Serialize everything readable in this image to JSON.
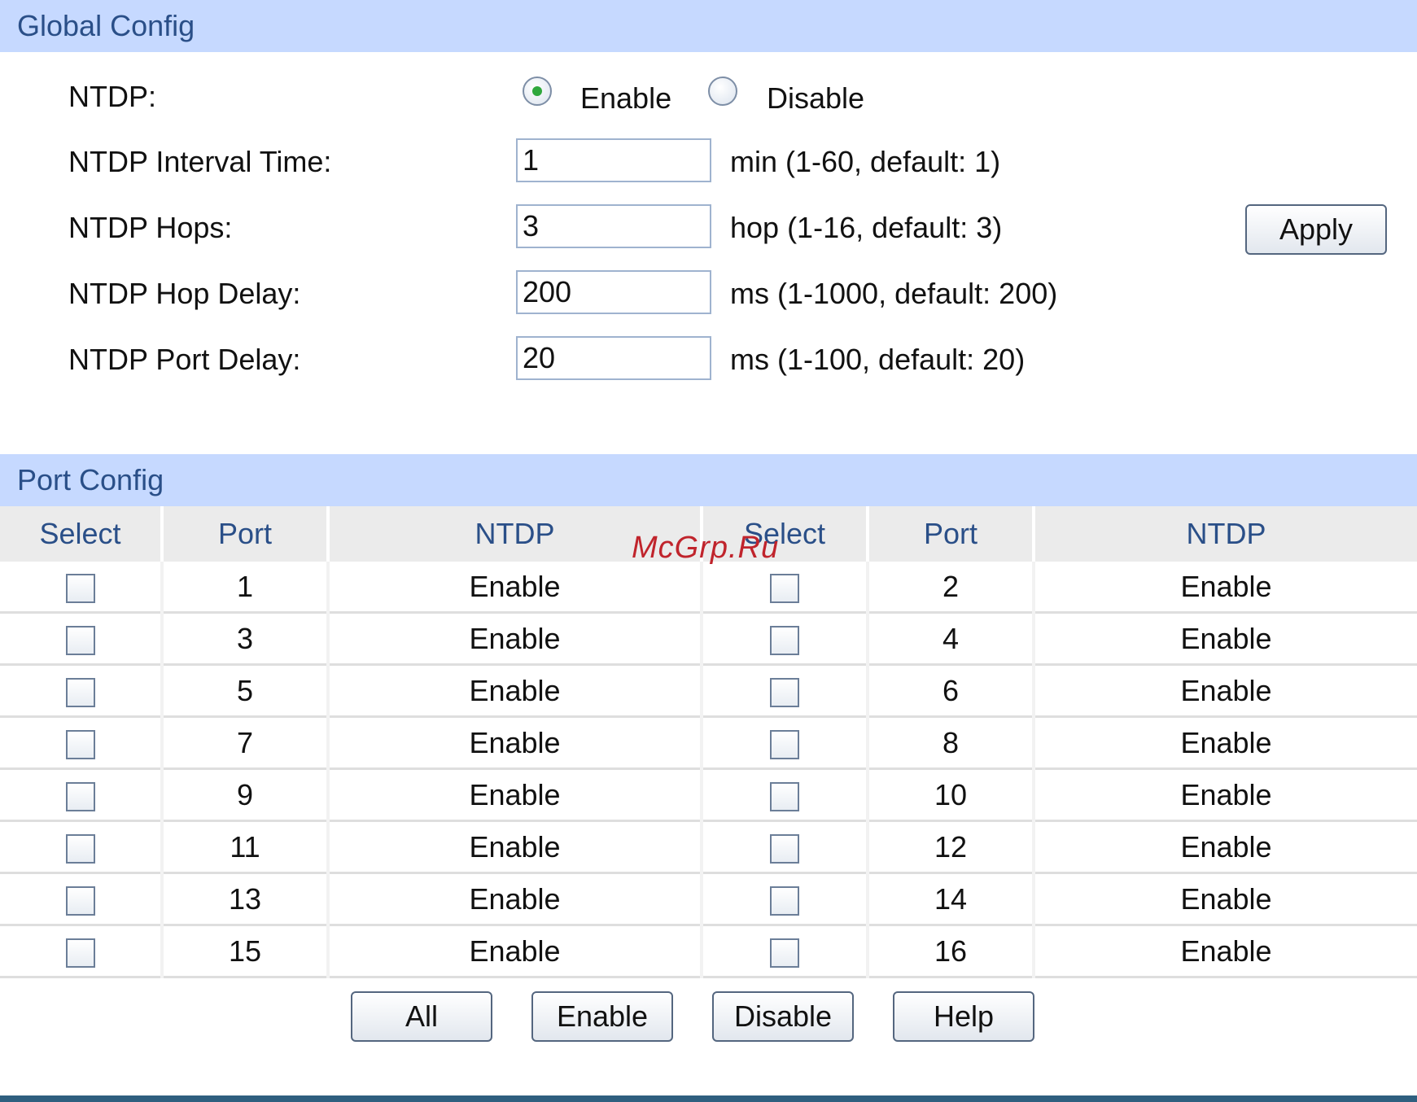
{
  "global_config": {
    "title": "Global Config",
    "ntdp": {
      "label": "NTDP:",
      "options": [
        "Enable",
        "Disable"
      ],
      "selected": "Enable"
    },
    "fields": [
      {
        "label": "NTDP Interval Time:",
        "value": "1",
        "hint": "min (1-60, default: 1)"
      },
      {
        "label": "NTDP Hops:",
        "value": "3",
        "hint": "hop (1-16, default: 3)"
      },
      {
        "label": "NTDP Hop Delay:",
        "value": "200",
        "hint": "ms (1-1000, default: 200)"
      },
      {
        "label": "NTDP Port Delay:",
        "value": "20",
        "hint": "ms (1-100, default: 20)"
      }
    ],
    "apply_label": "Apply"
  },
  "port_config": {
    "title": "Port Config",
    "columns": [
      "Select",
      "Port",
      "NTDP",
      "Select",
      "Port",
      "NTDP"
    ],
    "rows": [
      {
        "port_a": "1",
        "ntdp_a": "Enable",
        "port_b": "2",
        "ntdp_b": "Enable"
      },
      {
        "port_a": "3",
        "ntdp_a": "Enable",
        "port_b": "4",
        "ntdp_b": "Enable"
      },
      {
        "port_a": "5",
        "ntdp_a": "Enable",
        "port_b": "6",
        "ntdp_b": "Enable"
      },
      {
        "port_a": "7",
        "ntdp_a": "Enable",
        "port_b": "8",
        "ntdp_b": "Enable"
      },
      {
        "port_a": "9",
        "ntdp_a": "Enable",
        "port_b": "10",
        "ntdp_b": "Enable"
      },
      {
        "port_a": "11",
        "ntdp_a": "Enable",
        "port_b": "12",
        "ntdp_b": "Enable"
      },
      {
        "port_a": "13",
        "ntdp_a": "Enable",
        "port_b": "14",
        "ntdp_b": "Enable"
      },
      {
        "port_a": "15",
        "ntdp_a": "Enable",
        "port_b": "16",
        "ntdp_b": "Enable"
      }
    ],
    "buttons": [
      "All",
      "Enable",
      "Disable",
      "Help"
    ]
  },
  "watermark": "McGrp.Ru",
  "colors": {
    "header_bg": "#c6d9ff",
    "header_text": "#2a4f88",
    "radio_selected": "#2fa83c"
  }
}
